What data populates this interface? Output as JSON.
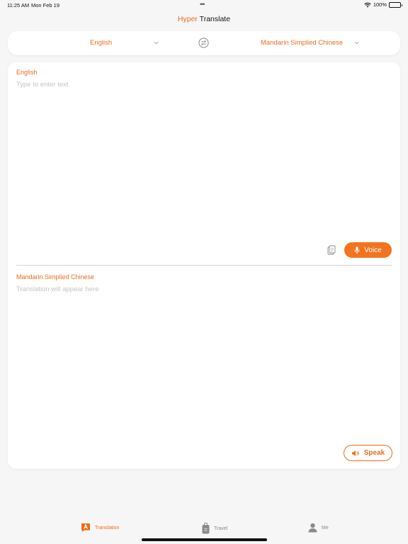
{
  "status_bar": {
    "time": "11:25 AM",
    "date": "Mon Feb 19",
    "multitask": "•••",
    "battery": "100%"
  },
  "header": {
    "title_part1": "Hyper",
    "title_part2": "Translate"
  },
  "languages": {
    "source": "English",
    "target": "Mandarin Simplied Chinese"
  },
  "source_panel": {
    "label": "English",
    "placeholder": "Type to enter text",
    "voice_label": "Voice"
  },
  "target_panel": {
    "label": "Mandarin Simplied Chinese",
    "placeholder": "Translation will appear here",
    "speak_label": "Speak"
  },
  "tabs": [
    {
      "label": "Translation",
      "icon": "translation-icon",
      "active": true
    },
    {
      "label": "Travel",
      "icon": "luggage-icon",
      "active": false
    },
    {
      "label": "Me",
      "icon": "person-icon",
      "active": false
    }
  ],
  "colors": {
    "accent": "#ee6a1c",
    "button": "#f27420",
    "background": "#f6f6f7",
    "placeholder": "#c4c4c4"
  }
}
